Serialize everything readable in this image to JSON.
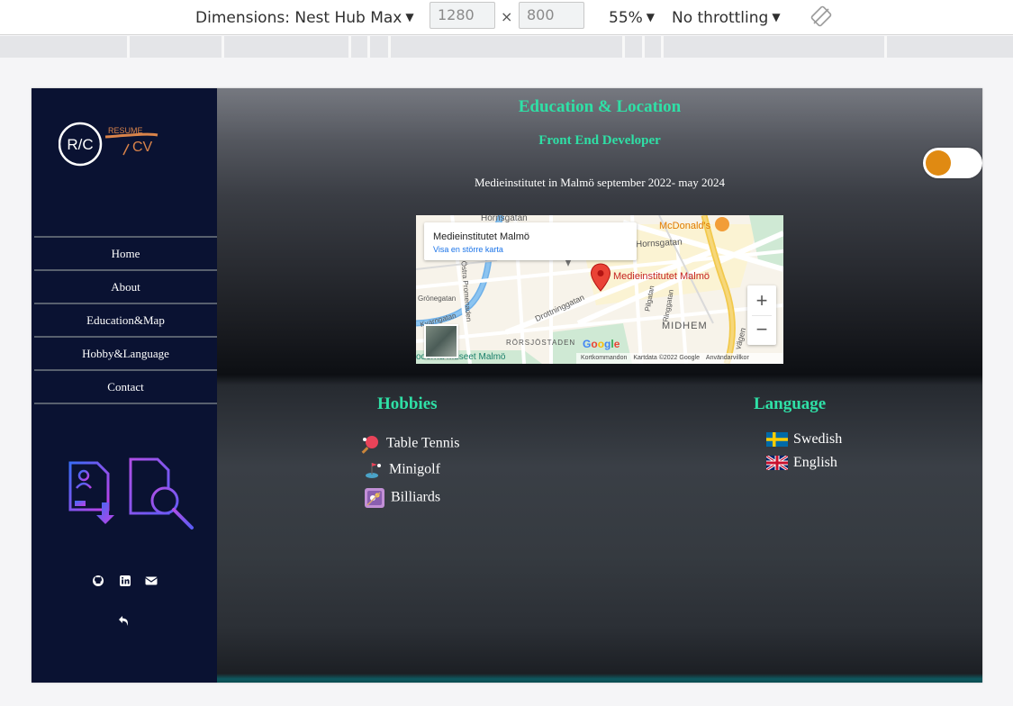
{
  "devtools": {
    "dimensions_label": "Dimensions: Nest Hub Max",
    "width": "1280",
    "height": "800",
    "times": "×",
    "zoom": "55%",
    "throttling": "No throttling"
  },
  "sidebar": {
    "logo": {
      "monogram": "R/C",
      "resume": "RESUME",
      "cv": "CV"
    },
    "nav": [
      "Home",
      "About",
      "Education&Map",
      "Hobby&Language",
      "Contact"
    ]
  },
  "main": {
    "title": "Education & Location",
    "subtitle": "Front End Developer",
    "education": "Medieinstitutet in Malmö september 2022- may 2024"
  },
  "map": {
    "place_title": "Medieinstitutet Malmö",
    "place_link": "Visa en större karta",
    "pin_label": "Medieinstitutet Malmö",
    "labels": {
      "hornsgatan1": "Hornsgatan",
      "hornsgatan2": "Hornsgatan",
      "mcdonalds": "McDonald's",
      "gronegatan": "Grönegatan",
      "ostra_promenaden": "Östra Promenaden",
      "kvarngatan": "Kvarngatan",
      "drottninggatan": "Drottninggatan",
      "pilgatan": "Pilgatan",
      "ringgatan": "Ringgatan",
      "midhem": "MIDHEM",
      "rorsjostaden": "RÖRSJÖSTADEN",
      "moderna": "oderna Museet Malmö",
      "vagen": "vägen"
    },
    "footer": [
      "Kortkommandon",
      "Kartdata ©2022 Google",
      "Användarvillkor"
    ],
    "zoom_in": "+",
    "zoom_out": "−"
  },
  "hobbies": {
    "title": "Hobbies",
    "items": [
      "Table Tennis",
      "Minigolf",
      "Billiards"
    ]
  },
  "languages": {
    "title": "Language",
    "items": [
      "Swedish",
      "English"
    ]
  },
  "colors": {
    "accent": "#2fe0a6",
    "sidebar": "#0a1232",
    "toggle": "#e08a12"
  }
}
